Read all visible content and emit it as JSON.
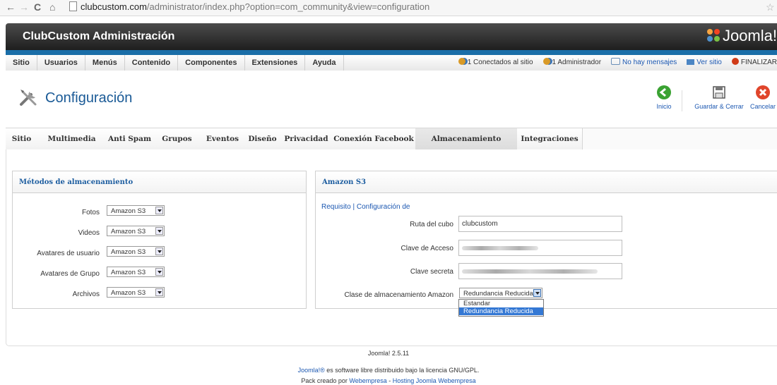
{
  "browser": {
    "url_host": "clubcustom.com",
    "url_path": "/administrator/index.php?option=com_community&view=configuration"
  },
  "header": {
    "site_title": "ClubCustom Administración",
    "logo_text": "Joomla!"
  },
  "menubar": {
    "items": [
      "Sitio",
      "Usuarios",
      "Menús",
      "Contenido",
      "Componentes",
      "Extensiones",
      "Ayuda"
    ],
    "status": {
      "online": "1 Conectados al sitio",
      "admins": "1 Administrador",
      "messages": "No hay mensajes",
      "view_site": "Ver sitio",
      "logout": "FINALIZAR"
    }
  },
  "toolbar": {
    "page_title": "Configuración",
    "buttons": {
      "home": "Inicio",
      "save_close": "Guardar & Cerrar",
      "cancel": "Cancelar"
    }
  },
  "tabs": [
    "Sitio",
    "Multimedia",
    "Anti Spam",
    "Grupos",
    "Eventos",
    "Diseño",
    "Privacidad",
    "Conexión Facebook",
    "Almacenamiento remoto",
    "Integraciones"
  ],
  "active_tab": "Almacenamiento remoto",
  "storage_methods": {
    "title": "Métodos de almacenamiento",
    "rows": [
      {
        "label": "Fotos",
        "value": "Amazon S3"
      },
      {
        "label": "Videos",
        "value": "Amazon S3"
      },
      {
        "label": "Avatares de usuario",
        "value": "Amazon S3"
      },
      {
        "label": "Avatares de Grupo",
        "value": "Amazon S3"
      },
      {
        "label": "Archivos",
        "value": "Amazon S3"
      }
    ]
  },
  "amazon_s3": {
    "title": "Amazon S3",
    "links": "Requisito | Configuración de",
    "bucket_label": "Ruta del cubo",
    "bucket_value": "clubcustom",
    "access_key_label": "Clave de Acceso",
    "secret_key_label": "Clave secreta",
    "storage_class_label": "Clase de almacenamiento Amazon",
    "storage_class_value": "Redundancia Reducida",
    "storage_class_options": [
      "Estandar",
      "Redundancia Reducida"
    ]
  },
  "footer": {
    "version": "Joomla! 2.5.11",
    "license_link": "Joomla!®",
    "license_text": "es software libre distribuido bajo la licencia GNU/GPL.",
    "credit_prefix": "Pack creado por",
    "credit_link1": "Webempresa",
    "credit_sep": " - ",
    "credit_link2": "Hosting Joomla Webempresa"
  },
  "colors": {
    "accent_blue": "#1a6ea8",
    "header_dark": "#1e1e1e",
    "link": "#1b57b1",
    "selected_option": "#3478d4"
  }
}
